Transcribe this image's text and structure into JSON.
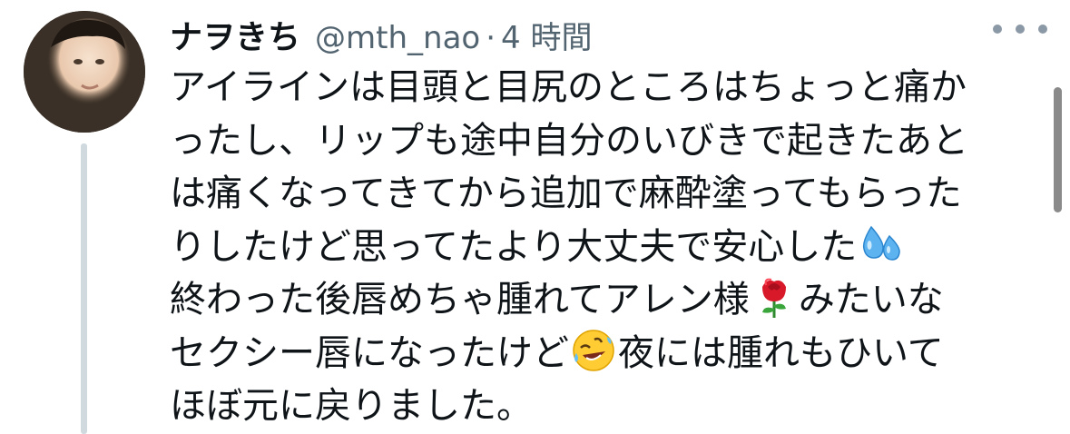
{
  "tweet": {
    "author": {
      "display_name": "ナヲきち",
      "handle": "@mth_nao",
      "avatar": "profile-photo"
    },
    "separator": "·",
    "timestamp": "4 時間",
    "more_icon": "more-horizontal-icon",
    "text_lines": [
      "アイラインは目頭と目尻のところはちょっと痛か",
      "ったし、リップも途中自分のいびきで起きたあと",
      "は痛くなってきてから追加で麻酔塗ってもらった",
      "りしたけど思ってたより大丈夫で安心した",
      "終わった後唇めちゃ腫れてアレン様",
      "みたいな",
      "セクシー唇になったけど",
      "夜には腫れもひいて",
      "ほぼ元に戻りました。"
    ],
    "emojis": {
      "sweat": "sweat-droplets-emoji",
      "rose": "rose-emoji",
      "rofl": "rolling-on-floor-laughing-emoji"
    }
  },
  "colors": {
    "text": "#0f1419",
    "secondary": "#536471",
    "thread_line": "#cfd9de"
  }
}
